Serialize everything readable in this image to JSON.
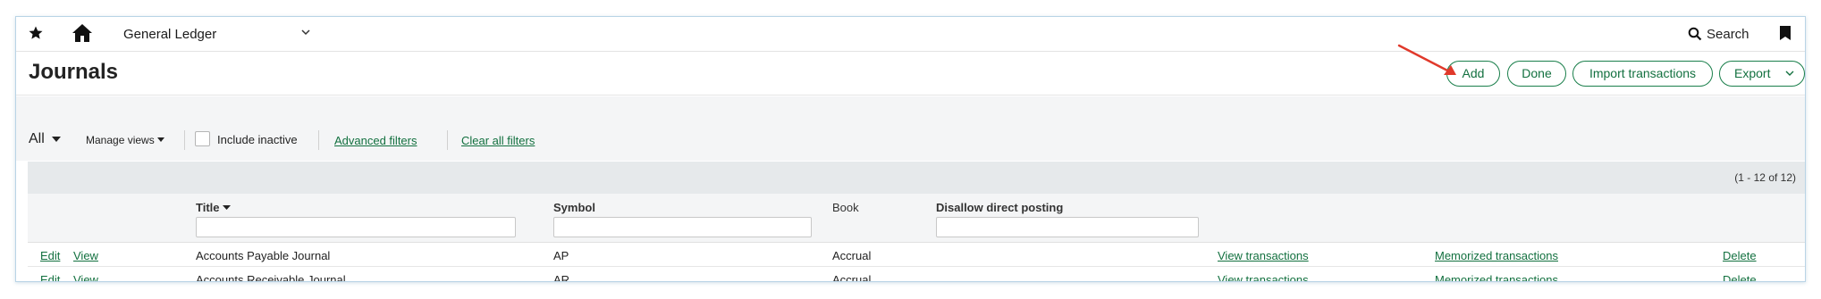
{
  "nav": {
    "app_name": "General Ledger",
    "search_label": "Search"
  },
  "page": {
    "title": "Journals"
  },
  "actions": {
    "add": "Add",
    "done": "Done",
    "import": "Import transactions",
    "export": "Export"
  },
  "filters": {
    "view": "All",
    "manage_views": "Manage views",
    "include_inactive": "Include inactive",
    "include_inactive_checked": false,
    "advanced_filters": "Advanced filters",
    "clear_all_filters": "Clear all filters"
  },
  "table": {
    "count": "(1 - 12 of 12)",
    "columns": {
      "title": "Title",
      "symbol": "Symbol",
      "book": "Book",
      "disallow": "Disallow direct posting"
    },
    "rows": [
      {
        "edit": "Edit",
        "view": "View",
        "title": "Accounts Payable Journal",
        "symbol": "AP",
        "book": "Accrual",
        "view_transactions": "View transactions",
        "memorized": "Memorized transactions",
        "delete": "Delete"
      },
      {
        "edit": "Edit",
        "view": "View",
        "title": "Accounts Receivable Journal",
        "symbol": "AR",
        "book": "Accrual",
        "view_transactions": "View transactions",
        "memorized": "Memorized transactions",
        "delete": "Delete"
      }
    ]
  },
  "colors": {
    "accent_green": "#12703f",
    "annotation_arrow": "#e0392b"
  },
  "icons": [
    "star-icon",
    "home-icon",
    "chevron-down-icon",
    "search-icon",
    "bookmark-icon",
    "caret-down-icon",
    "arrow-annotation"
  ]
}
